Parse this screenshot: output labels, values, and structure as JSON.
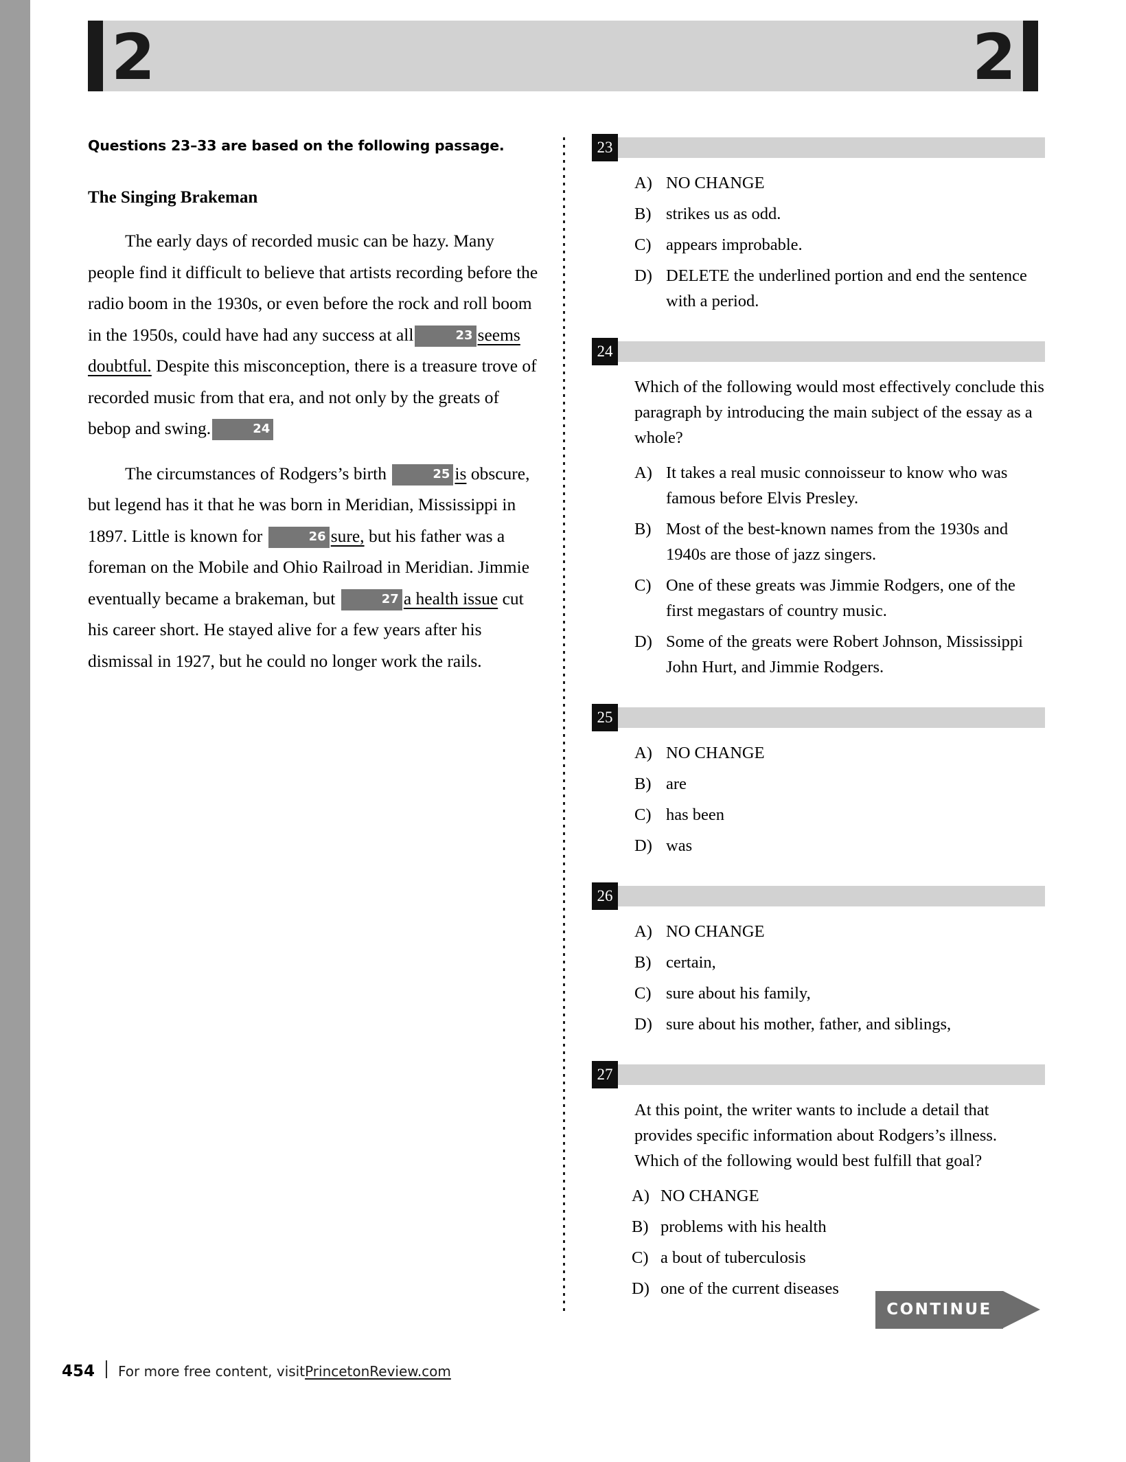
{
  "header": {
    "section_number_left": "2",
    "section_number_right": "2"
  },
  "passage": {
    "intro": "Questions 23–33 are based on the following passage.",
    "title": "The Singing Brakeman",
    "paragraph1": {
      "part1": "The early days of recorded music can be hazy. Many people find it difficult to believe that artists recording before the radio boom in the 1930s, or even before the rock and roll boom in the 1950s, could have had any success at all",
      "marker1": "23",
      "underlined1": "seems doubtful.",
      "part2": "Despite this misconception, there is a treasure trove of recorded music from that era, and not only by the greats of bebop and swing.",
      "marker2": "24"
    },
    "paragraph2": {
      "part1": "The circumstances of Rodgers’s birth",
      "marker1": "25",
      "underlined1": "is",
      "part2": "obscure, but legend has it that he was born in Meridian, Mississippi in 1897. Little is known for",
      "marker2": "26",
      "underlined2": "sure,",
      "part3": "but his father was a foreman on the Mobile and Ohio Railroad in Meridian. Jimmie eventually became a brakeman, but",
      "marker3": "27",
      "underlined3": "a health issue",
      "part4": "cut his career short. He stayed alive for a few years after his dismissal in 1927, but he could no longer work the rails."
    }
  },
  "questions": [
    {
      "number": "23",
      "stem": "",
      "choices": [
        {
          "letter": "A)",
          "text": "NO CHANGE"
        },
        {
          "letter": "B)",
          "text": "strikes us as odd."
        },
        {
          "letter": "C)",
          "text": "appears improbable."
        },
        {
          "letter": "D)",
          "text": "DELETE the underlined portion and end the sentence with a period."
        }
      ]
    },
    {
      "number": "24",
      "stem": "Which of the following would most effectively conclude this paragraph by introducing the main subject of the essay as a whole?",
      "choices": [
        {
          "letter": "A)",
          "text": "It takes a real music connoisseur to know who was famous before Elvis Presley."
        },
        {
          "letter": "B)",
          "text": "Most of the best-known names from the 1930s and 1940s are those of jazz singers."
        },
        {
          "letter": "C)",
          "text": "One of these greats was Jimmie Rodgers, one of the first megastars of country music."
        },
        {
          "letter": "D)",
          "text": "Some of the greats were Robert Johnson, Mississippi John Hurt, and Jimmie Rodgers."
        }
      ]
    },
    {
      "number": "25",
      "stem": "",
      "choices": [
        {
          "letter": "A)",
          "text": "NO CHANGE"
        },
        {
          "letter": "B)",
          "text": "are"
        },
        {
          "letter": "C)",
          "text": "has been"
        },
        {
          "letter": "D)",
          "text": "was"
        }
      ]
    },
    {
      "number": "26",
      "stem": "",
      "choices": [
        {
          "letter": "A)",
          "text": "NO CHANGE"
        },
        {
          "letter": "B)",
          "text": "certain,"
        },
        {
          "letter": "C)",
          "text": "sure about his family,"
        },
        {
          "letter": "D)",
          "text": "sure about his mother, father, and siblings,"
        }
      ]
    },
    {
      "number": "27",
      "stem": "At this point, the writer wants to include a detail that provides specific information about Rodgers’s illness. Which of the following would best fulfill that goal?",
      "choices": [
        {
          "letter": "A)",
          "text": "NO CHANGE"
        },
        {
          "letter": "B)",
          "text": "problems with his health"
        },
        {
          "letter": "C)",
          "text": "a bout of tuberculosis"
        },
        {
          "letter": "D)",
          "text": "one of the current diseases"
        }
      ]
    }
  ],
  "continue_button": {
    "label": "CONTINUE"
  },
  "footer": {
    "page_number": "454",
    "text": "For more free content, visit ",
    "link": "PrincetonReview.com"
  },
  "colors": {
    "header_band": "#d2d2d2",
    "header_rule": "#1a1a1a",
    "question_number_box": "#0f0f0f",
    "inline_marker": "#767676",
    "continue": "#6d6d6d",
    "binding_strip": "#9d9d9d"
  }
}
